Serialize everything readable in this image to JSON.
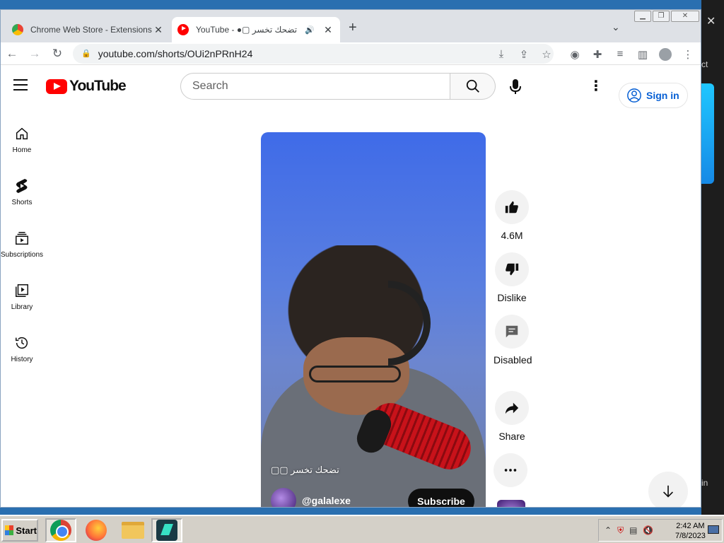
{
  "browser": {
    "tabs": [
      {
        "title": "Chrome Web Store - Extensions",
        "favicon": "chrome-web-store-icon"
      },
      {
        "title": "YouTube - ●▢ تضحك تخسر",
        "favicon": "youtube-icon",
        "audio": "speaker-icon"
      }
    ],
    "url": "youtube.com/shorts/OUi2nPRnH24"
  },
  "youtube": {
    "logo_text": "YouTube",
    "search_placeholder": "Search",
    "signin_label": "Sign in",
    "guide": [
      {
        "label": "Home",
        "icon": "home-icon"
      },
      {
        "label": "Shorts",
        "icon": "shorts-icon"
      },
      {
        "label": "Subscriptions",
        "icon": "subscriptions-icon"
      },
      {
        "label": "Library",
        "icon": "library-icon"
      },
      {
        "label": "History",
        "icon": "history-icon"
      }
    ],
    "short": {
      "caption": "تضحك تخسر ▢▢",
      "channel": "@galalexe",
      "subscribe_label": "Subscribe"
    },
    "actions": {
      "likes": "4.6M",
      "dislike": "Dislike",
      "comments": "Disabled",
      "share": "Share"
    }
  },
  "desktop": {
    "side_text_1": "ct",
    "side_text_2": "in"
  },
  "taskbar": {
    "start_label": "Start",
    "time": "2:42 AM",
    "date": "7/8/2023"
  },
  "colors": {
    "youtube_red": "#ff0000",
    "signin_blue": "#065fd4",
    "tab_strip": "#dee1e6"
  }
}
